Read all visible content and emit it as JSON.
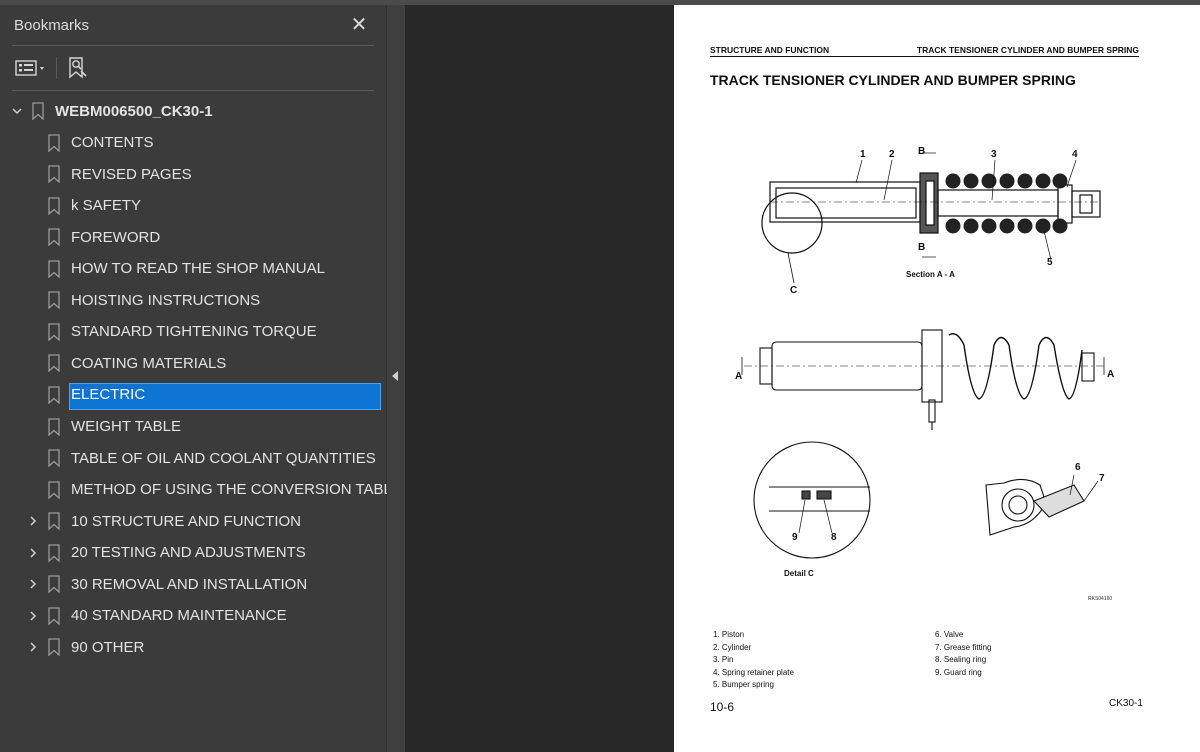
{
  "panel": {
    "title": "Bookmarks",
    "close_icon": "close-icon",
    "options_icon": "list-options-icon",
    "bookmark_search_icon": "bookmark-search-icon"
  },
  "tree": {
    "root": "WEBM006500_CK30-1",
    "items": [
      {
        "label": "CONTENTS"
      },
      {
        "label": "REVISED PAGES"
      },
      {
        "label": "k SAFETY"
      },
      {
        "label": "FOREWORD"
      },
      {
        "label": "HOW TO READ THE SHOP MANUAL"
      },
      {
        "label": "HOISTING INSTRUCTIONS"
      },
      {
        "label": "STANDARD TIGHTENING TORQUE"
      },
      {
        "label": "COATING MATERIALS"
      },
      {
        "label": "ELECTRIC",
        "selected": true
      },
      {
        "label": "WEIGHT TABLE"
      },
      {
        "label": "TABLE OF OIL AND COOLANT QUANTITIES"
      },
      {
        "label": "METHOD OF USING THE CONVERSION TABLE"
      },
      {
        "label": "10 STRUCTURE AND FUNCTION",
        "expandable": true
      },
      {
        "label": "20 TESTING AND ADJUSTMENTS",
        "expandable": true
      },
      {
        "label": "30 REMOVAL AND INSTALLATION",
        "expandable": true
      },
      {
        "label": "40 STANDARD MAINTENANCE",
        "expandable": true
      },
      {
        "label": "90 OTHER",
        "expandable": true
      }
    ]
  },
  "colors": {
    "selection": "#0e74d3",
    "panel_bg": "#3b3b3b",
    "viewer_bg": "#282828"
  },
  "page": {
    "header_left": "STRUCTURE AND FUNCTION",
    "header_right": "TRACK TENSIONER CYLINDER AND BUMPER SPRING",
    "title": "TRACK TENSIONER CYLINDER AND BUMPER SPRING",
    "section_label": "Section A - A",
    "detail_label": "Detail C",
    "figure_code": "RKS04160",
    "callouts": {
      "n1": "1",
      "n2": "2",
      "n3": "3",
      "n4": "4",
      "n5": "5",
      "n6": "6",
      "n7": "7",
      "n8": "8",
      "n9": "9",
      "b": "B",
      "a": "A",
      "c": "C"
    },
    "parts_left": [
      "1.  Piston",
      "2.  Cylinder",
      "3.  Pin",
      "4.  Spring retainer plate",
      "5.  Bumper spring"
    ],
    "parts_right": [
      "6.  Valve",
      "7.  Grease fitting",
      "8.  Sealing ring",
      "9.  Guard ring"
    ],
    "page_number": "10-6",
    "model": "CK30-1"
  }
}
